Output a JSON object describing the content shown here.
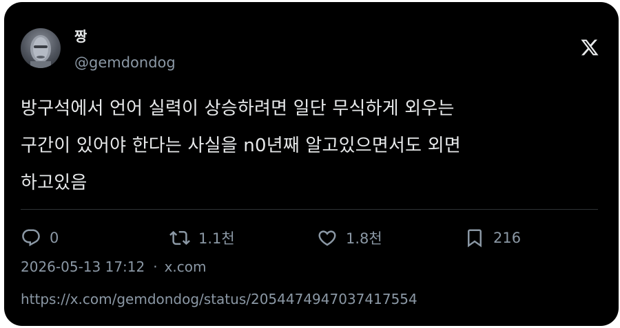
{
  "author": {
    "display_name": "짱",
    "handle": "@gemdondog",
    "avatar_icon": "avatar-image"
  },
  "brand": {
    "logo_icon": "x-logo-icon"
  },
  "tweet": {
    "lines": [
      "방구석에서 언어 실력이 상승하려면 일단 무식하게 외우는",
      "구간이 있어야 한다는 사실을 n0년째 알고있으면서도 외면",
      "하고있음"
    ]
  },
  "actions": {
    "reply": {
      "icon": "reply-icon",
      "count": "0"
    },
    "retweet": {
      "icon": "retweet-icon",
      "count": "1.1천"
    },
    "like": {
      "icon": "heart-icon",
      "count": "1.8천"
    },
    "bookmark": {
      "icon": "bookmark-icon",
      "count": "216"
    }
  },
  "meta": {
    "timestamp": "2026-05-13 17:12",
    "separator": "·",
    "source": "x.com",
    "url": "https://x.com/gemdondog/status/2054474947037417554"
  },
  "colors": {
    "background": "#000000",
    "text": "#e7e9ea",
    "secondary": "#8b98a5",
    "divider": "#2f3336"
  }
}
